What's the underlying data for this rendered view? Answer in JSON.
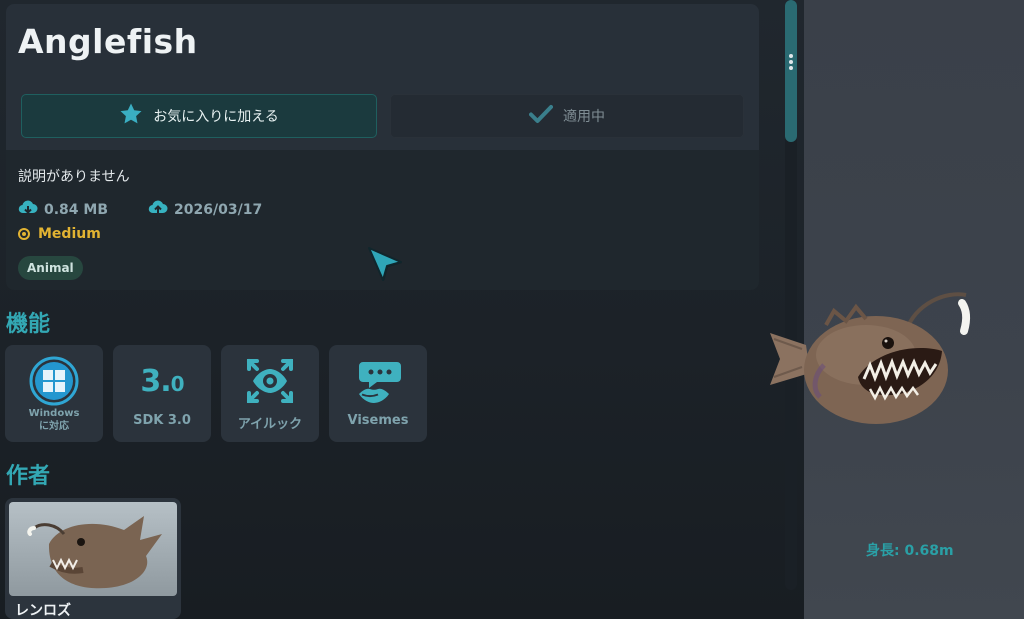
{
  "avatar": {
    "title": "Anglefish",
    "favorite_label": "お気に入りに加える",
    "applied_label": "適用中",
    "description": "説明がありません",
    "file_size": "0.84 MB",
    "updated": "2026/03/17",
    "performance": "Medium",
    "tag": "Animal"
  },
  "features": {
    "title": "機能",
    "items": [
      {
        "label_line1": "Windows",
        "label_line2": "に対応",
        "icon": "windows-icon"
      },
      {
        "label": "SDK 3.0",
        "icon_text_main": "3.",
        "icon_text_small": "0"
      },
      {
        "label": "アイルック",
        "icon": "eye-look-icon"
      },
      {
        "label": "Visemes",
        "icon": "visemes-icon"
      }
    ]
  },
  "author": {
    "title": "作者",
    "name": "レンロズ"
  },
  "preview": {
    "height_label": "身長: 0.68m"
  },
  "colors": {
    "accent": "#33a8b4",
    "performance_medium": "#e1b332"
  }
}
